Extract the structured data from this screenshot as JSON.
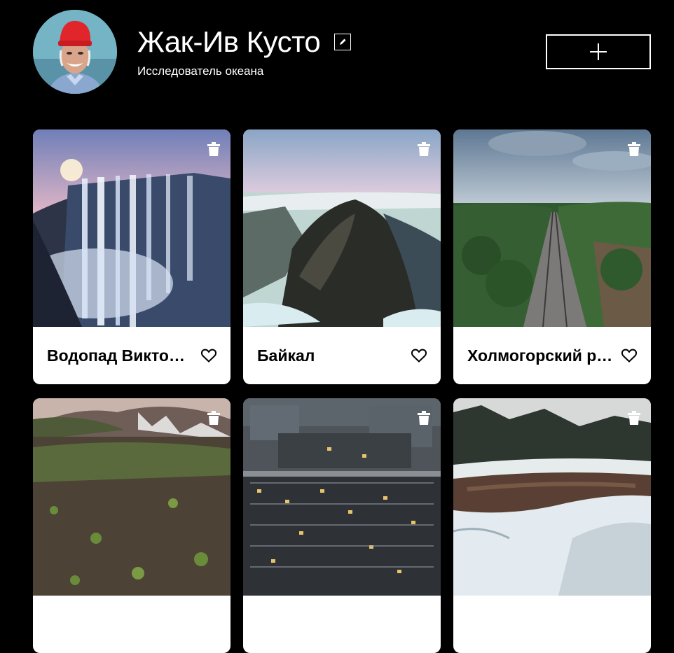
{
  "profile": {
    "name": "Жак-Ив Кусто",
    "about": "Исследователь океана",
    "avatar_icon": "avatar-portrait",
    "edit_icon": "pencil-icon",
    "add_icon": "plus-icon"
  },
  "cards": [
    {
      "title": "Водопад Виктория",
      "scene": "waterfall"
    },
    {
      "title": "Байкал",
      "scene": "cliff"
    },
    {
      "title": "Холмогорский район",
      "scene": "railway"
    },
    {
      "title": "",
      "scene": "volcano"
    },
    {
      "title": "",
      "scene": "city"
    },
    {
      "title": "",
      "scene": "river"
    }
  ],
  "icons": {
    "delete": "trash-icon",
    "like": "heart-outline-icon"
  },
  "colors": {
    "background": "#000000",
    "card": "#ffffff",
    "text_dark": "#000000",
    "text_light": "#ffffff"
  }
}
